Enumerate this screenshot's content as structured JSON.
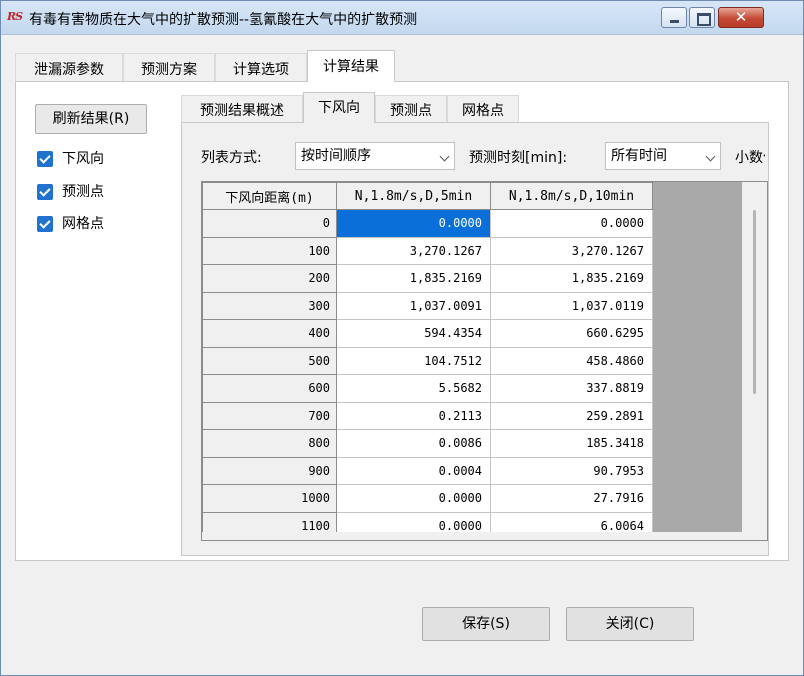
{
  "window": {
    "app_icon_text": "RS",
    "title": "有毒有害物质在大气中的扩散预测--氢氰酸在大气中的扩散预测",
    "close_symbol": "✕"
  },
  "main_tabs": [
    {
      "label": "泄漏源参数"
    },
    {
      "label": "预测方案"
    },
    {
      "label": "计算选项"
    },
    {
      "label": "计算结果"
    }
  ],
  "left_panel": {
    "refresh_label": "刷新结果(R)",
    "checks": [
      {
        "label": "下风向",
        "checked": true
      },
      {
        "label": "预测点",
        "checked": true
      },
      {
        "label": "网格点",
        "checked": true
      }
    ]
  },
  "sub_tabs": [
    {
      "label": "预测结果概述"
    },
    {
      "label": "下风向"
    },
    {
      "label": "预测点"
    },
    {
      "label": "网格点"
    }
  ],
  "options": {
    "list_mode_label": "列表方式:",
    "list_mode_value": "按时间顺序",
    "time_label": "预测时刻[min]:",
    "time_value": "所有时间",
    "decimal_label": "小数位"
  },
  "grid": {
    "headers": [
      "下风向距离(m)",
      "N,1.8m/s,D,5min",
      "N,1.8m/s,D,10min"
    ],
    "rows": [
      [
        "0",
        "0.0000",
        "0.0000"
      ],
      [
        "100",
        "3,270.1267",
        "3,270.1267"
      ],
      [
        "200",
        "1,835.2169",
        "1,835.2169"
      ],
      [
        "300",
        "1,037.0091",
        "1,037.0119"
      ],
      [
        "400",
        "594.4354",
        "660.6295"
      ],
      [
        "500",
        "104.7512",
        "458.4860"
      ],
      [
        "600",
        "5.5682",
        "337.8819"
      ],
      [
        "700",
        "0.2113",
        "259.2891"
      ],
      [
        "800",
        "0.0086",
        "185.3418"
      ],
      [
        "900",
        "0.0004",
        "90.7953"
      ],
      [
        "1000",
        "0.0000",
        "27.7916"
      ],
      [
        "1100",
        "0.0000",
        "6.0064"
      ]
    ]
  },
  "buttons": {
    "save": "保存(S)",
    "close": "关闭(C)"
  }
}
